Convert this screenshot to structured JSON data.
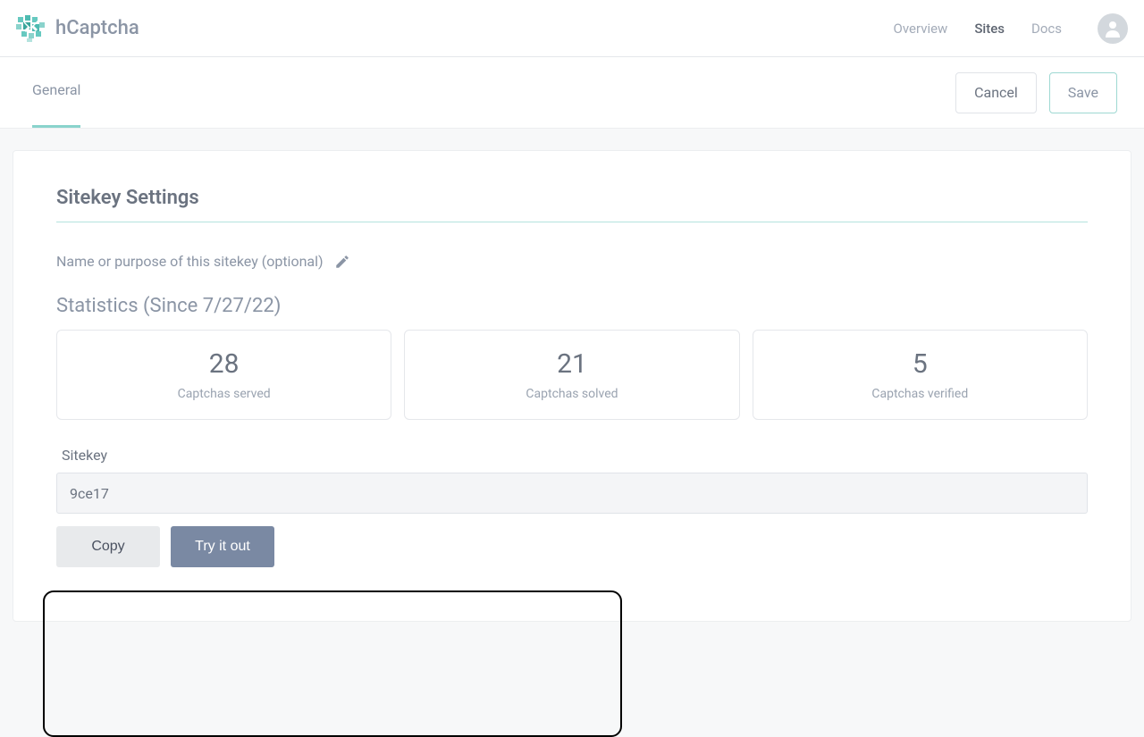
{
  "brand": "hCaptcha",
  "nav": {
    "overview": "Overview",
    "sites": "Sites",
    "docs": "Docs"
  },
  "subheader": {
    "tab_general": "General",
    "cancel": "Cancel",
    "save": "Save"
  },
  "settings": {
    "title": "Sitekey Settings",
    "name_label": "Name or purpose of this sitekey (optional)",
    "stats_title": "Statistics (Since 7/27/22)",
    "stats": [
      {
        "value": "28",
        "label": "Captchas served"
      },
      {
        "value": "21",
        "label": "Captchas solved"
      },
      {
        "value": "5",
        "label": "Captchas verified"
      }
    ],
    "sitekey_label": "Sitekey",
    "sitekey_value": "9ce17",
    "copy": "Copy",
    "try": "Try it out"
  }
}
